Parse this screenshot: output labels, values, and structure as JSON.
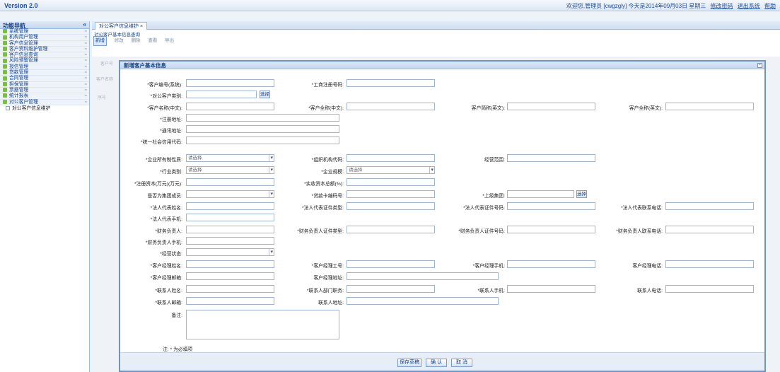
{
  "header": {
    "version": "Version 2.0",
    "user_info": "欢迎您,管理员 [cwgzgly] 今天是2014年09月03日 星期三",
    "links": [
      "修改密码",
      "退出系统",
      "帮助"
    ]
  },
  "sidebar": {
    "title": "功能导航",
    "collapse_icon": "double-chevron-left-icon",
    "items": [
      {
        "label": "系统管理"
      },
      {
        "label": "机构用户管理"
      },
      {
        "label": "客户信息管理"
      },
      {
        "label": "客户资料维护管理"
      },
      {
        "label": "客户信息查询"
      },
      {
        "label": "风险预警管理"
      },
      {
        "label": "授信管理"
      },
      {
        "label": "贷款管理"
      },
      {
        "label": "合同管理"
      },
      {
        "label": "担保管理"
      },
      {
        "label": "票据管理"
      },
      {
        "label": "统计报表"
      },
      {
        "label": "对公客户管理"
      }
    ],
    "sub_items": [
      {
        "label": "对公客户信息维护"
      }
    ]
  },
  "main": {
    "tab_label": "对公客户信息维护 ×",
    "panel_title": "对公客户基本信息查询",
    "toolbar": [
      "新增",
      "修改",
      "删除",
      "查看",
      "导出"
    ],
    "list_stubs": [
      "客户号",
      "客户名称",
      "序号"
    ]
  },
  "modal": {
    "title": "新增客户基本信息",
    "fields": {
      "r1": {
        "a": "*客户编号(系统):",
        "b": "*工商注册号码:"
      },
      "r2": {
        "a": "*对公客户类别:",
        "btn": "选择"
      },
      "r3": {
        "a": "*客户名称(中文):",
        "b": "*客户全称(中文):",
        "c": "客户简称(英文):",
        "d": "客户全称(英文):"
      },
      "r4": {
        "a": "*注册地址:"
      },
      "r5": {
        "a": "*通讯地址:"
      },
      "r6": {
        "a": "*统一社会信用代码:"
      },
      "r7": {
        "a": "*企业所有制性质:",
        "a_val": "请选择",
        "b": "*组织机构代码:",
        "c": "经营范围:"
      },
      "r8": {
        "a": "*行业类别:",
        "a_val": "请选择",
        "b": "*企业规模:",
        "b_val": "请选择"
      },
      "r9": {
        "a": "*注册资本(万元)(万元):",
        "b": "*实收资本总额(%):"
      },
      "r10": {
        "a": "是否为集团成员:",
        "b": "*贷款卡编码号:",
        "c": "*上级集团:",
        "btn": "选择"
      },
      "r11": {
        "a": "*法人代表姓名:",
        "b": "*法人代表证件类型:",
        "c": "*法人代表证件号码:",
        "d": "*法人代表联系电话:"
      },
      "r12": {
        "a": "*法人代表手机:"
      },
      "r13": {
        "a": "*财务负责人:",
        "b": "*财务负责人证件类型:",
        "c": "*财务负责人证件号码:",
        "d": "*财务负责人联系电话:"
      },
      "r14": {
        "a": "*财务负责人手机:"
      },
      "r15": {
        "a": "*经营状态:"
      },
      "r16": {
        "a": "*客户经理姓名:",
        "b": "*客户经理工号:",
        "c": "*客户经理手机:",
        "d": "客户经理电话:"
      },
      "r17": {
        "a": "*客户经理邮箱:",
        "b": "客户经理地址:"
      },
      "r18": {
        "a": "*联系人姓名:",
        "b": "*联系人部门职务:",
        "c": "*联系人手机:",
        "d": "联系人电话:"
      },
      "r19": {
        "a": "*联系人邮箱:",
        "b": "联系人地址:"
      },
      "r20": {
        "a": "备注:"
      }
    },
    "note": "注: * 为必填项",
    "buttons": [
      "保存草稿",
      "确 认",
      "取 消"
    ]
  }
}
